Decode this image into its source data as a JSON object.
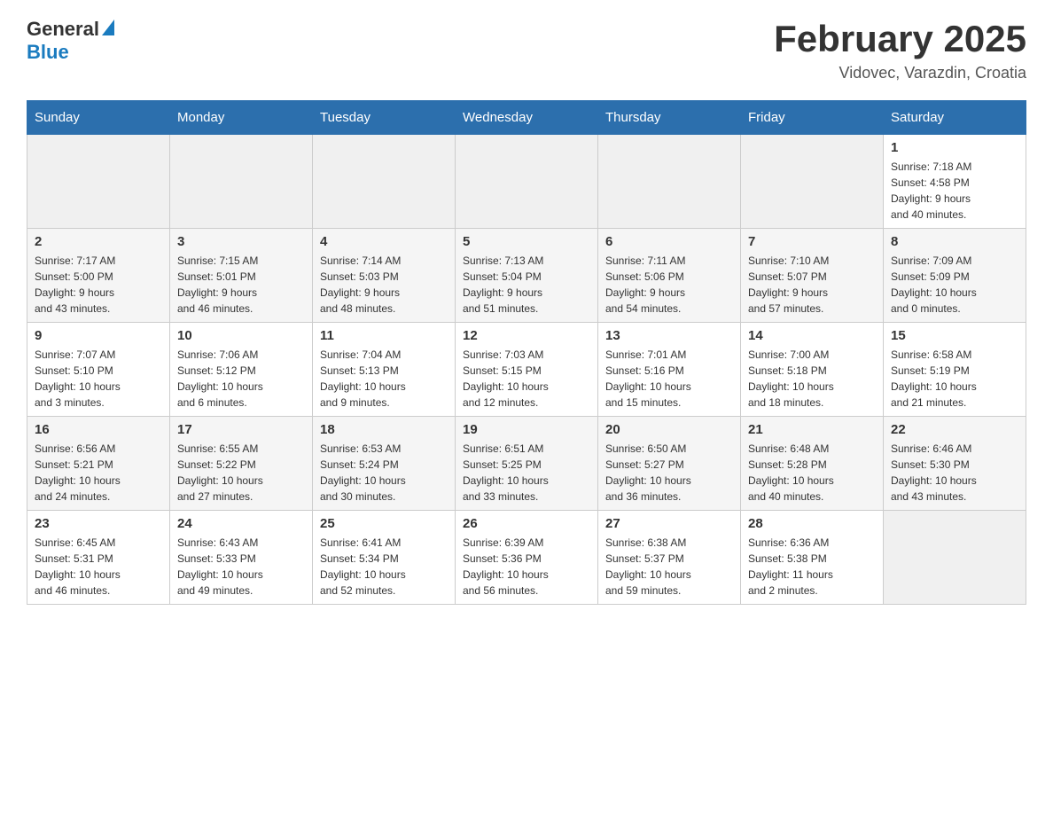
{
  "header": {
    "logo_general": "General",
    "logo_blue": "Blue",
    "month_title": "February 2025",
    "location": "Vidovec, Varazdin, Croatia"
  },
  "days_of_week": [
    "Sunday",
    "Monday",
    "Tuesday",
    "Wednesday",
    "Thursday",
    "Friday",
    "Saturday"
  ],
  "weeks": [
    {
      "days": [
        {
          "number": "",
          "info": ""
        },
        {
          "number": "",
          "info": ""
        },
        {
          "number": "",
          "info": ""
        },
        {
          "number": "",
          "info": ""
        },
        {
          "number": "",
          "info": ""
        },
        {
          "number": "",
          "info": ""
        },
        {
          "number": "1",
          "info": "Sunrise: 7:18 AM\nSunset: 4:58 PM\nDaylight: 9 hours\nand 40 minutes."
        }
      ]
    },
    {
      "days": [
        {
          "number": "2",
          "info": "Sunrise: 7:17 AM\nSunset: 5:00 PM\nDaylight: 9 hours\nand 43 minutes."
        },
        {
          "number": "3",
          "info": "Sunrise: 7:15 AM\nSunset: 5:01 PM\nDaylight: 9 hours\nand 46 minutes."
        },
        {
          "number": "4",
          "info": "Sunrise: 7:14 AM\nSunset: 5:03 PM\nDaylight: 9 hours\nand 48 minutes."
        },
        {
          "number": "5",
          "info": "Sunrise: 7:13 AM\nSunset: 5:04 PM\nDaylight: 9 hours\nand 51 minutes."
        },
        {
          "number": "6",
          "info": "Sunrise: 7:11 AM\nSunset: 5:06 PM\nDaylight: 9 hours\nand 54 minutes."
        },
        {
          "number": "7",
          "info": "Sunrise: 7:10 AM\nSunset: 5:07 PM\nDaylight: 9 hours\nand 57 minutes."
        },
        {
          "number": "8",
          "info": "Sunrise: 7:09 AM\nSunset: 5:09 PM\nDaylight: 10 hours\nand 0 minutes."
        }
      ]
    },
    {
      "days": [
        {
          "number": "9",
          "info": "Sunrise: 7:07 AM\nSunset: 5:10 PM\nDaylight: 10 hours\nand 3 minutes."
        },
        {
          "number": "10",
          "info": "Sunrise: 7:06 AM\nSunset: 5:12 PM\nDaylight: 10 hours\nand 6 minutes."
        },
        {
          "number": "11",
          "info": "Sunrise: 7:04 AM\nSunset: 5:13 PM\nDaylight: 10 hours\nand 9 minutes."
        },
        {
          "number": "12",
          "info": "Sunrise: 7:03 AM\nSunset: 5:15 PM\nDaylight: 10 hours\nand 12 minutes."
        },
        {
          "number": "13",
          "info": "Sunrise: 7:01 AM\nSunset: 5:16 PM\nDaylight: 10 hours\nand 15 minutes."
        },
        {
          "number": "14",
          "info": "Sunrise: 7:00 AM\nSunset: 5:18 PM\nDaylight: 10 hours\nand 18 minutes."
        },
        {
          "number": "15",
          "info": "Sunrise: 6:58 AM\nSunset: 5:19 PM\nDaylight: 10 hours\nand 21 minutes."
        }
      ]
    },
    {
      "days": [
        {
          "number": "16",
          "info": "Sunrise: 6:56 AM\nSunset: 5:21 PM\nDaylight: 10 hours\nand 24 minutes."
        },
        {
          "number": "17",
          "info": "Sunrise: 6:55 AM\nSunset: 5:22 PM\nDaylight: 10 hours\nand 27 minutes."
        },
        {
          "number": "18",
          "info": "Sunrise: 6:53 AM\nSunset: 5:24 PM\nDaylight: 10 hours\nand 30 minutes."
        },
        {
          "number": "19",
          "info": "Sunrise: 6:51 AM\nSunset: 5:25 PM\nDaylight: 10 hours\nand 33 minutes."
        },
        {
          "number": "20",
          "info": "Sunrise: 6:50 AM\nSunset: 5:27 PM\nDaylight: 10 hours\nand 36 minutes."
        },
        {
          "number": "21",
          "info": "Sunrise: 6:48 AM\nSunset: 5:28 PM\nDaylight: 10 hours\nand 40 minutes."
        },
        {
          "number": "22",
          "info": "Sunrise: 6:46 AM\nSunset: 5:30 PM\nDaylight: 10 hours\nand 43 minutes."
        }
      ]
    },
    {
      "days": [
        {
          "number": "23",
          "info": "Sunrise: 6:45 AM\nSunset: 5:31 PM\nDaylight: 10 hours\nand 46 minutes."
        },
        {
          "number": "24",
          "info": "Sunrise: 6:43 AM\nSunset: 5:33 PM\nDaylight: 10 hours\nand 49 minutes."
        },
        {
          "number": "25",
          "info": "Sunrise: 6:41 AM\nSunset: 5:34 PM\nDaylight: 10 hours\nand 52 minutes."
        },
        {
          "number": "26",
          "info": "Sunrise: 6:39 AM\nSunset: 5:36 PM\nDaylight: 10 hours\nand 56 minutes."
        },
        {
          "number": "27",
          "info": "Sunrise: 6:38 AM\nSunset: 5:37 PM\nDaylight: 10 hours\nand 59 minutes."
        },
        {
          "number": "28",
          "info": "Sunrise: 6:36 AM\nSunset: 5:38 PM\nDaylight: 11 hours\nand 2 minutes."
        },
        {
          "number": "",
          "info": ""
        }
      ]
    }
  ]
}
